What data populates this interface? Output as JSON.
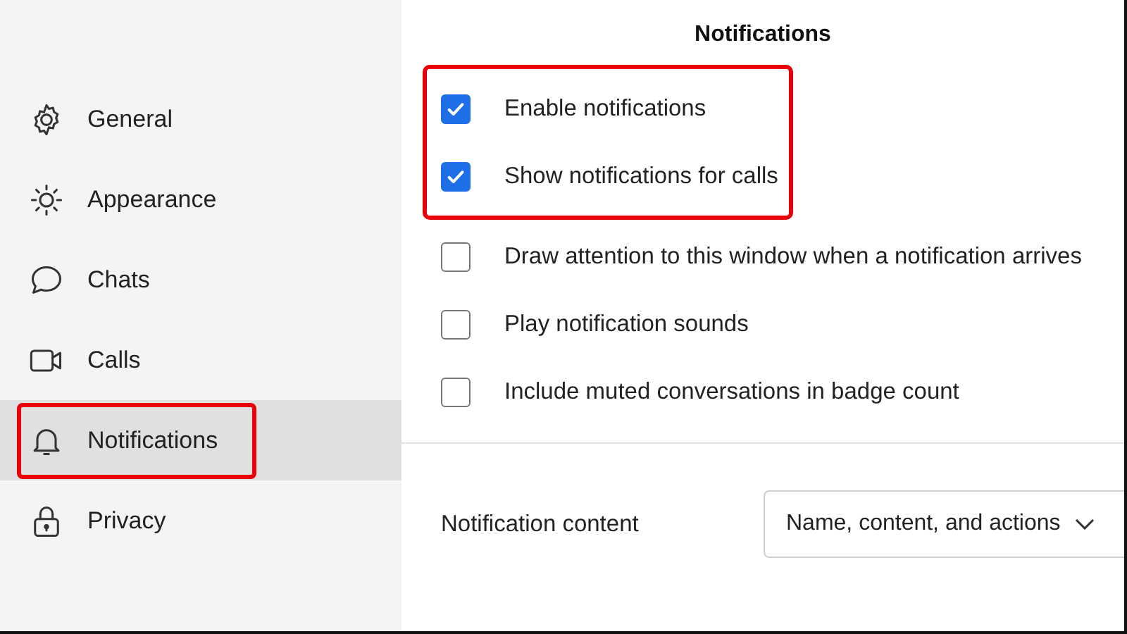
{
  "sidebar": {
    "items": [
      {
        "label": "General",
        "selected": false,
        "highlighted": false
      },
      {
        "label": "Appearance",
        "selected": false,
        "highlighted": false
      },
      {
        "label": "Chats",
        "selected": false,
        "highlighted": false
      },
      {
        "label": "Calls",
        "selected": false,
        "highlighted": false
      },
      {
        "label": "Notifications",
        "selected": true,
        "highlighted": true
      },
      {
        "label": "Privacy",
        "selected": false,
        "highlighted": false
      }
    ]
  },
  "panel": {
    "title": "Notifications",
    "options": [
      {
        "label": "Enable notifications",
        "checked": true,
        "highlighted": true
      },
      {
        "label": "Show notifications for calls",
        "checked": true,
        "highlighted": true
      },
      {
        "label": "Draw attention to this window when a notification arrives",
        "checked": false,
        "highlighted": false
      },
      {
        "label": "Play notification sounds",
        "checked": false,
        "highlighted": false
      },
      {
        "label": "Include muted conversations in badge count",
        "checked": false,
        "highlighted": false
      }
    ],
    "content_setting": {
      "label": "Notification content",
      "value": "Name, content, and actions"
    }
  }
}
